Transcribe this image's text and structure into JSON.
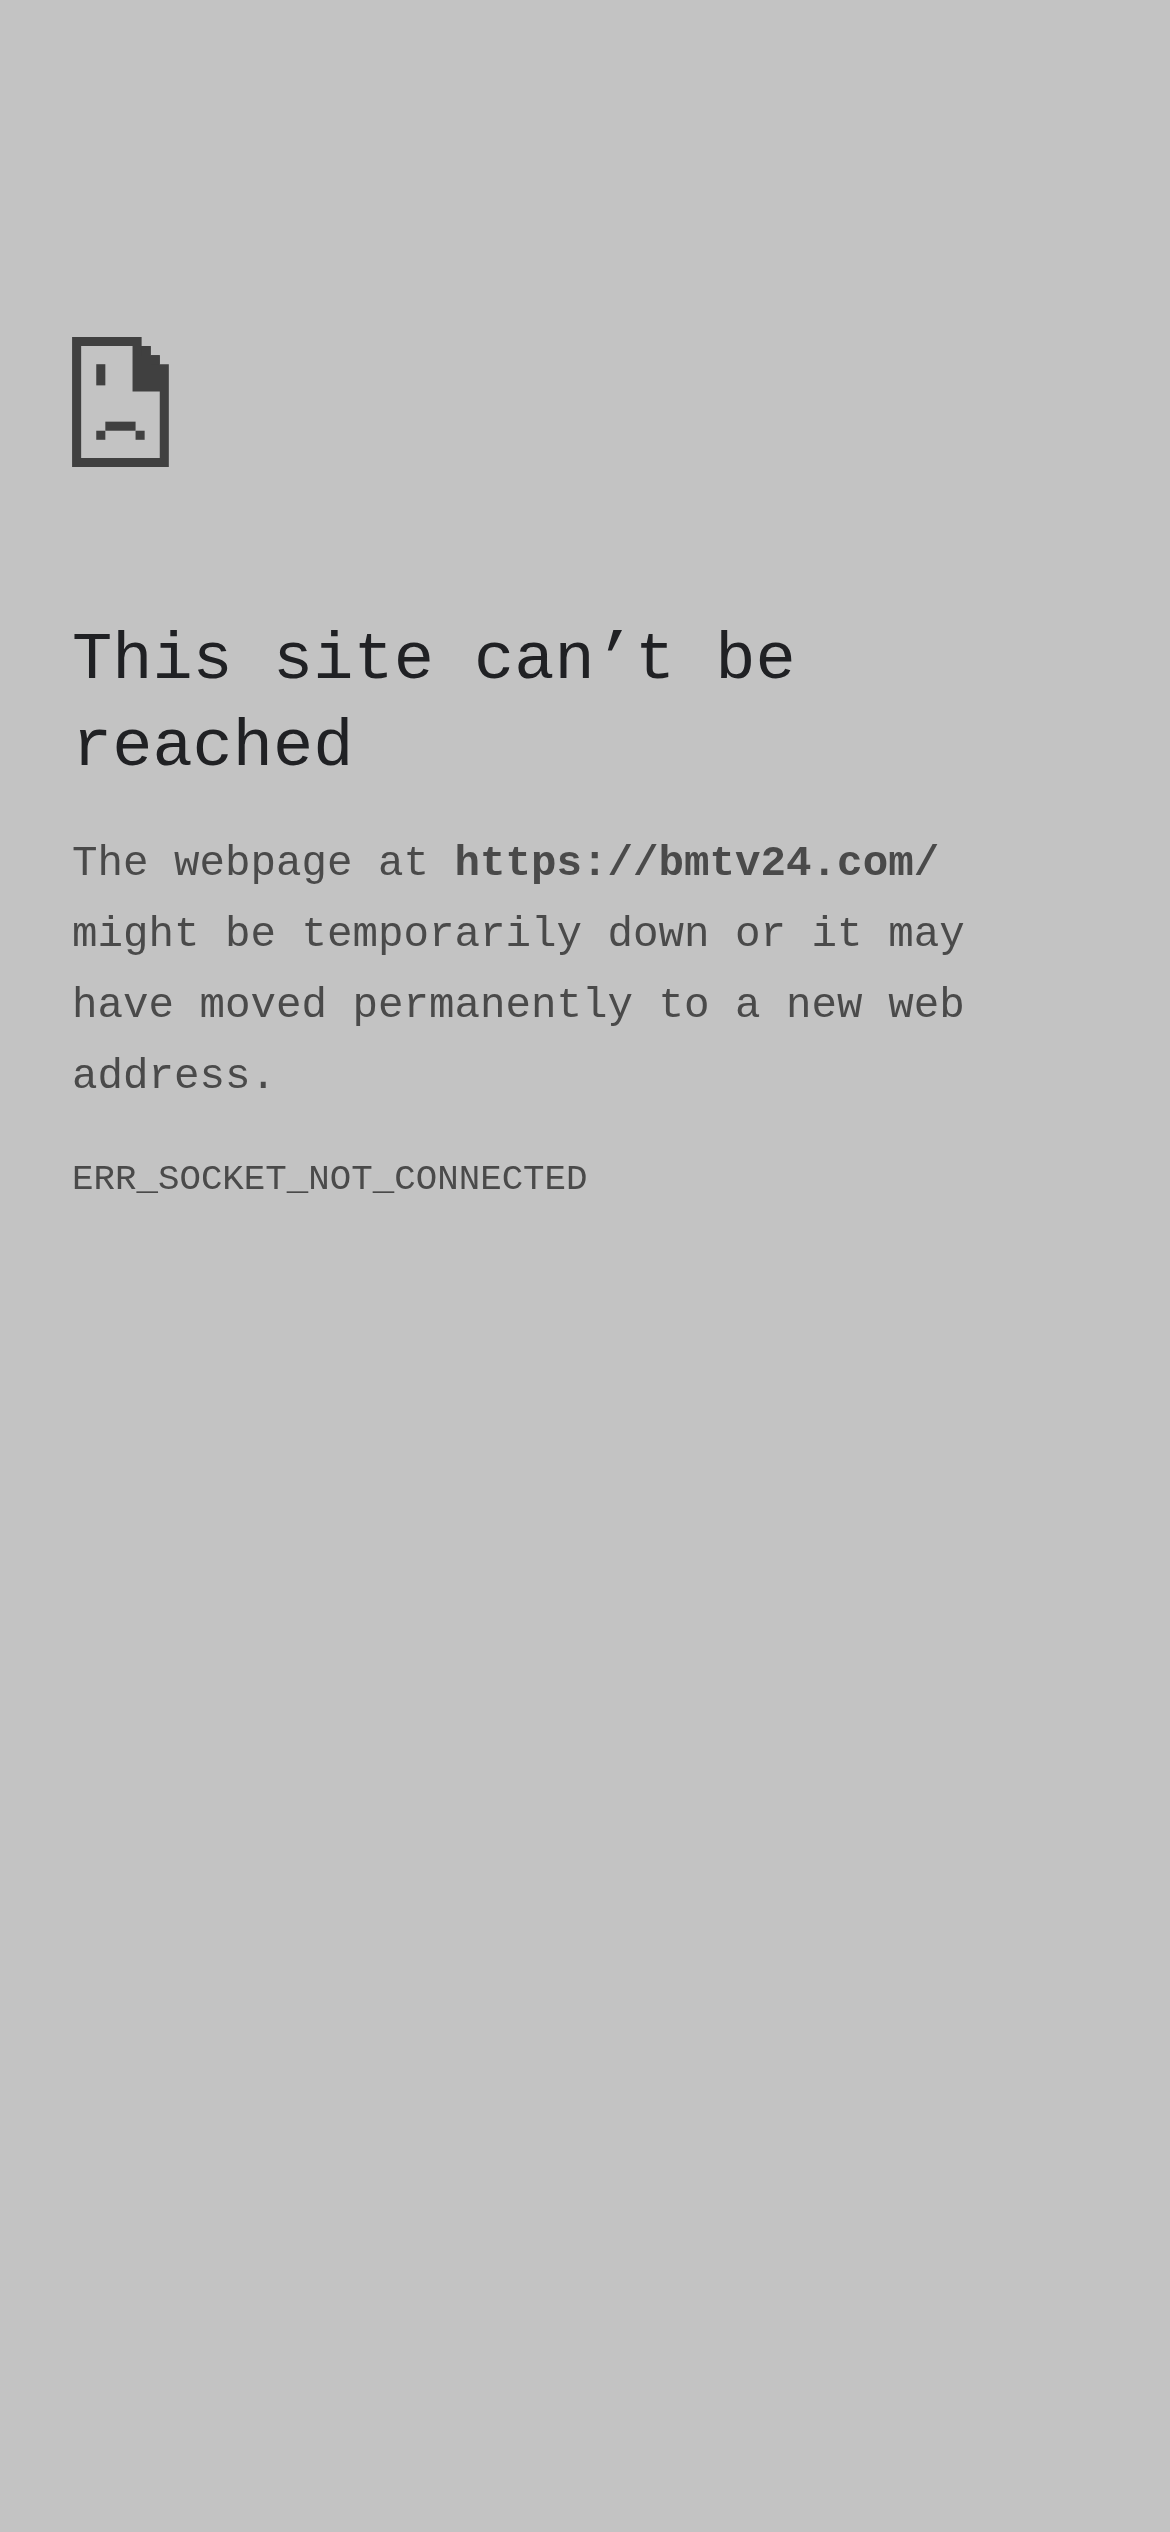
{
  "error_page": {
    "title": "This site can’t be reached",
    "message": "The webpage at **https://bmtv24.com/** might be temporarily down or it may have moved permanently to a new web address.",
    "error_code": "ERR_SOCKET_NOT_CONNECTED"
  }
}
